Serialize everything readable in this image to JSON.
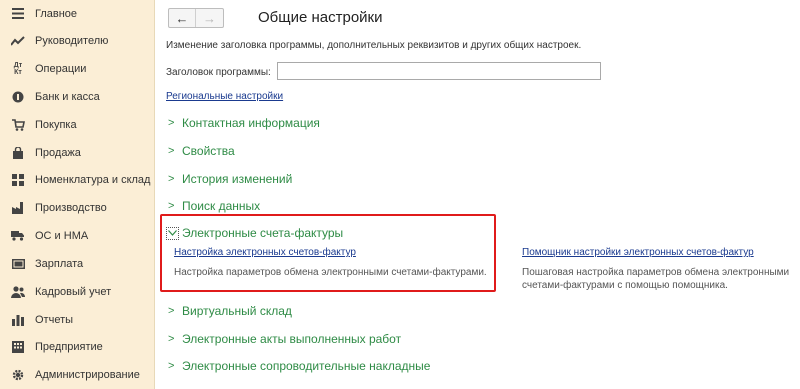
{
  "sidebar": {
    "items": [
      {
        "label": "Главное",
        "icon": "menu-icon"
      },
      {
        "label": "Руководителю",
        "icon": "trend-icon"
      },
      {
        "label": "Операции",
        "icon": "debit-credit-icon"
      },
      {
        "label": "Банк и касса",
        "icon": "coin-icon"
      },
      {
        "label": "Покупка",
        "icon": "cart-icon"
      },
      {
        "label": "Продажа",
        "icon": "bag-icon"
      },
      {
        "label": "Номенклатура и склад",
        "icon": "grid-icon"
      },
      {
        "label": "Производство",
        "icon": "factory-icon"
      },
      {
        "label": "ОС и НМА",
        "icon": "truck-icon"
      },
      {
        "label": "Зарплата",
        "icon": "money-icon"
      },
      {
        "label": "Кадровый учет",
        "icon": "people-icon"
      },
      {
        "label": "Отчеты",
        "icon": "bar-chart-icon"
      },
      {
        "label": "Предприятие",
        "icon": "building-icon"
      },
      {
        "label": "Администрирование",
        "icon": "gear-icon"
      }
    ]
  },
  "header": {
    "back_symbol": "←",
    "forward_symbol": "→",
    "title": "Общие настройки"
  },
  "main": {
    "description": "Изменение заголовка программы, дополнительных реквизитов и других общих настроек.",
    "program_title_label": "Заголовок программы:",
    "program_title_value": "",
    "regional_link": "Региональные настройки",
    "groups": [
      {
        "label": "Контактная информация",
        "expanded": false
      },
      {
        "label": "Свойства",
        "expanded": false
      },
      {
        "label": "История изменений",
        "expanded": false
      },
      {
        "label": "Поиск данных",
        "expanded": false
      },
      {
        "label": "Электронные счета-фактуры",
        "expanded": true
      },
      {
        "label": "Виртуальный склад",
        "expanded": false
      },
      {
        "label": "Электронные акты выполненных работ",
        "expanded": false
      },
      {
        "label": "Электронные сопроводительные накладные",
        "expanded": false
      }
    ],
    "invoice_section": {
      "left_link": "Настройка электронных счетов-фактур",
      "left_desc": "Настройка параметров обмена электронными счетами-фактурами.",
      "right_link": "Помощник настройки электронных счетов-фактур",
      "right_desc_line1": "Пошаговая настройка параметров обмена электронными",
      "right_desc_line2": "счетами-фактурами с помощью помощника."
    }
  },
  "colors": {
    "sidebar_bg": "#fbeed6",
    "group_green": "#2e8b45",
    "link_blue": "#1a3a8f",
    "highlight_red": "#e01b1b"
  }
}
